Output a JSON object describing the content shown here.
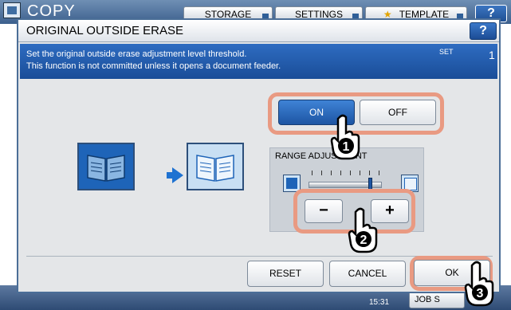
{
  "background": {
    "app_title": "COPY",
    "tabs": [
      "STORAGE",
      "SETTINGS",
      "TEMPLATE"
    ],
    "help_label": "?",
    "time": "15:31",
    "job_status_label": "JOB S"
  },
  "dialog": {
    "title": "ORIGINAL OUTSIDE ERASE",
    "help_label": "?",
    "message_line1": "Set the original outside erase adjustment level threshold.",
    "message_line2": "This function is not committed unless it opens a document feeder.",
    "set_label": "SET",
    "set_number": "1",
    "on_label": "ON",
    "off_label": "OFF",
    "on_selected": true,
    "range_label": "RANGE ADJUSTMENT",
    "range_level": 0.85,
    "minus_label": "−",
    "plus_label": "+",
    "reset_label": "RESET",
    "cancel_label": "CANCEL",
    "ok_label": "OK"
  },
  "callouts": [
    "1",
    "2",
    "3"
  ],
  "colors": {
    "selected_blue": "#1d55a3",
    "message_bar": "#2e6cc1",
    "highlight_ring": "#e99a82",
    "arrow": "#1e72d1"
  },
  "icons": [
    "book-dark-icon",
    "arrow-right-icon",
    "book-light-icon",
    "hand-pointer-icon",
    "star-icon"
  ]
}
